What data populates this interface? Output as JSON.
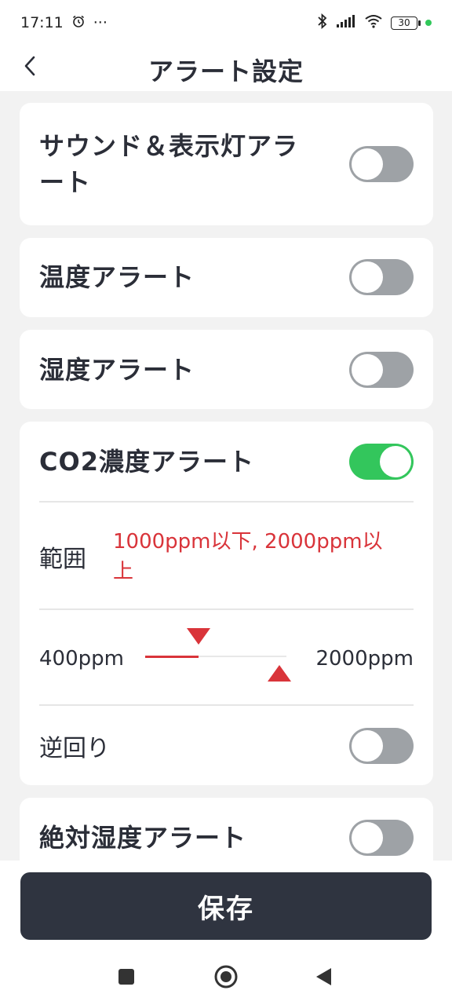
{
  "status": {
    "time": "17:11",
    "more": "···",
    "battery": "30"
  },
  "header": {
    "title": "アラート設定"
  },
  "alerts": {
    "sound_light": {
      "label_line1": "サウンド＆表示灯アラ",
      "label_line2": "ート",
      "enabled": false
    },
    "temperature": {
      "label": "温度アラート",
      "enabled": false
    },
    "humidity": {
      "label": "湿度アラート",
      "enabled": false
    },
    "co2": {
      "label": "CO2濃度アラート",
      "enabled": true,
      "range_label": "範囲",
      "range_value_line1": "1000ppm以下, 2000ppm以",
      "range_value_line2": "上",
      "slider_min": "400ppm",
      "slider_max": "2000ppm",
      "lower_threshold_fraction": 0.375,
      "upper_threshold_fraction": 0.95,
      "reverse_label": "逆回り",
      "reverse_enabled": false
    },
    "absolute_humidity": {
      "label": "絶対湿度アラート",
      "enabled": false
    }
  },
  "footer": {
    "save_label": "保存"
  },
  "colors": {
    "accent_red": "#d9343a",
    "toggle_on": "#33c65c",
    "toggle_off": "#9ea2a6",
    "save_button": "#2f3440"
  },
  "icons": {
    "back": "chevron-left-icon",
    "alarm": "alarm-clock-icon",
    "bluetooth": "bluetooth-icon",
    "signal": "cell-signal-icon",
    "wifi": "wifi-icon",
    "battery": "battery-icon",
    "nav_recent": "square-icon",
    "nav_home": "circle-icon",
    "nav_back": "triangle-back-icon"
  }
}
